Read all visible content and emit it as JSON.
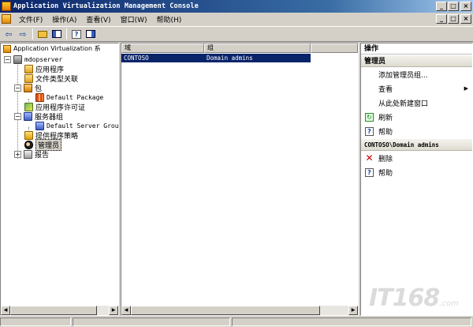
{
  "window": {
    "title": "Application Virtualization Management Console",
    "buttons": [
      "_",
      "□",
      "×"
    ]
  },
  "menu": {
    "items": [
      "文件(F)",
      "操作(A)",
      "查看(V)",
      "窗口(W)",
      "帮助(H)"
    ]
  },
  "toolbar": {
    "back": "⇦",
    "forward": "⇨"
  },
  "tree": {
    "root": "Application Virtualization 系",
    "nodes": [
      {
        "label": "mdopserver",
        "expander": "−"
      },
      {
        "label": "应用程序",
        "expander": ""
      },
      {
        "label": "文件类型关联",
        "expander": ""
      },
      {
        "label": "包",
        "expander": "−"
      },
      {
        "label": "Default Package",
        "expander": ""
      },
      {
        "label": "应用程序许可证",
        "expander": ""
      },
      {
        "label": "服务器组",
        "expander": "−"
      },
      {
        "label": "Default Server Grou",
        "expander": ""
      },
      {
        "label": "提供程序策略",
        "expander": ""
      },
      {
        "label": "管理员",
        "expander": ""
      },
      {
        "label": "报告",
        "expander": "+"
      }
    ]
  },
  "list": {
    "columns": [
      "域",
      "组"
    ],
    "rows": [
      {
        "domain": "CONTOSO",
        "group": "Domain admins"
      }
    ]
  },
  "actions": {
    "header": "操作",
    "section1": {
      "title": "管理员",
      "items": [
        {
          "label": "添加管理员组...",
          "icon": ""
        },
        {
          "label": "查看",
          "icon": "",
          "arrow": "▶"
        },
        {
          "label": "从此处新建窗口",
          "icon": ""
        },
        {
          "label": "刷新",
          "icon": "refresh-icon"
        },
        {
          "label": "帮助",
          "icon": "help-icon"
        }
      ]
    },
    "section2": {
      "title": "CONTOSO\\Domain admins",
      "items": [
        {
          "label": "删除",
          "icon": "delete-icon"
        },
        {
          "label": "帮助",
          "icon": "help-icon"
        }
      ]
    }
  },
  "watermark": {
    "text": "IT168",
    "suffix": ".com"
  }
}
